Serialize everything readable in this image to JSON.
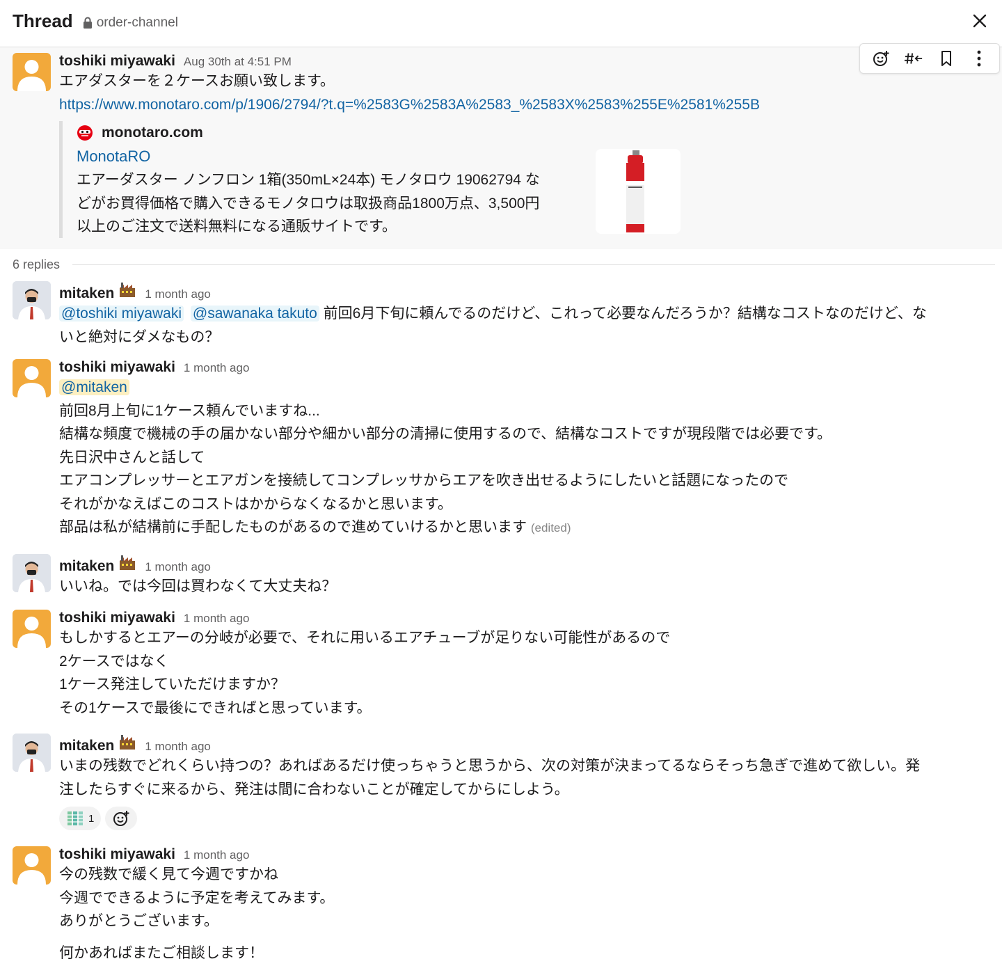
{
  "header": {
    "title": "Thread",
    "channel": "order-channel"
  },
  "parent": {
    "author": "toshiki miyawaki",
    "time": "Aug 30th at 4:51 PM",
    "text": "エアダスターを２ケースお願い致します。",
    "link": "https://www.monotaro.com/p/1906/2794/?t.q=%2583G%2583A%2583_%2583X%2583%255E%2581%255B",
    "unfurl": {
      "site": "monotaro.com",
      "title": "MonotaRO",
      "desc": [
        "エアーダスター ノンフロン 1箱(350mL×24本) モノタロウ 19062794 な",
        "どがお買得価格で購入できるモノタロウは取扱商品1800万点、3,500円",
        "以上のご注文で送料無料になる通販サイトです。"
      ]
    }
  },
  "replies_label": "6 replies",
  "replies": [
    {
      "author": "mitaken",
      "time": "1 month ago",
      "mention1": "@toshiki miyawaki",
      "mention2": "@sawanaka takuto",
      "text_first": "前回6月下旬に頼んでるのだけど、これって必要なんだろうか？結構なコストなのだけど、な",
      "text_second": "いと絶対にダメなもの？"
    },
    {
      "author": "toshiki miyawaki",
      "time": "1 month ago",
      "mention": "@mitaken",
      "lines": [
        "前回8月上旬に1ケース頼んでいますね...",
        "結構な頻度で機械の手の届かない部分や細かい部分の清掃に使用するので、結構なコストですが現段階では必要です。",
        "先日沢中さんと話して",
        "エアコンプレッサーとエアガンを接続してコンプレッサからエアを吹き出せるようにしたいと話題になったので",
        "それがかなえばこのコストはかからなくなるかと思います。",
        "部品は私が結構前に手配したものがあるので進めていけるかと思います"
      ],
      "edited": "(edited)"
    },
    {
      "author": "mitaken",
      "time": "1 month ago",
      "lines": [
        "いいね。では今回は買わなくて大丈夫ね？"
      ]
    },
    {
      "author": "toshiki miyawaki",
      "time": "1 month ago",
      "lines": [
        "もしかするとエアーの分岐が必要で、それに用いるエアチューブが足りない可能性があるので",
        "2ケースではなく",
        "1ケース発注していただけますか？",
        "その1ケースで最後にできればと思っています。"
      ]
    },
    {
      "author": "mitaken",
      "time": "1 month ago",
      "lines": [
        "いまの残数でどれくらい持つの？あればあるだけ使っちゃうと思うから、次の対策が決まってるならそっち急ぎで進めて欲しい。発",
        "注したらすぐに来るから、発注は間に合わないことが確定してからにしよう。"
      ],
      "reaction_count": "1"
    },
    {
      "author": "toshiki miyawaki",
      "time": "1 month ago",
      "lines": [
        "今の残数で緩く見て今週ですかね",
        "今週でできるように予定を考えてみます。",
        "ありがとうございます。"
      ],
      "last_line": "何かあればまたご相談します！"
    }
  ],
  "colors": {
    "link": "#1264a3",
    "mention_bg": "#e8f5fa",
    "mention_self_bg": "#fcefc1",
    "avatar": "#f2a93b"
  },
  "icons": {
    "lock": "lock-icon",
    "close": "close-icon",
    "add_reaction": "add-reaction-icon",
    "forward": "forward-to-channel-icon",
    "bookmark": "bookmark-icon",
    "more": "more-vertical-icon",
    "factory_badge": "factory-badge-icon"
  }
}
